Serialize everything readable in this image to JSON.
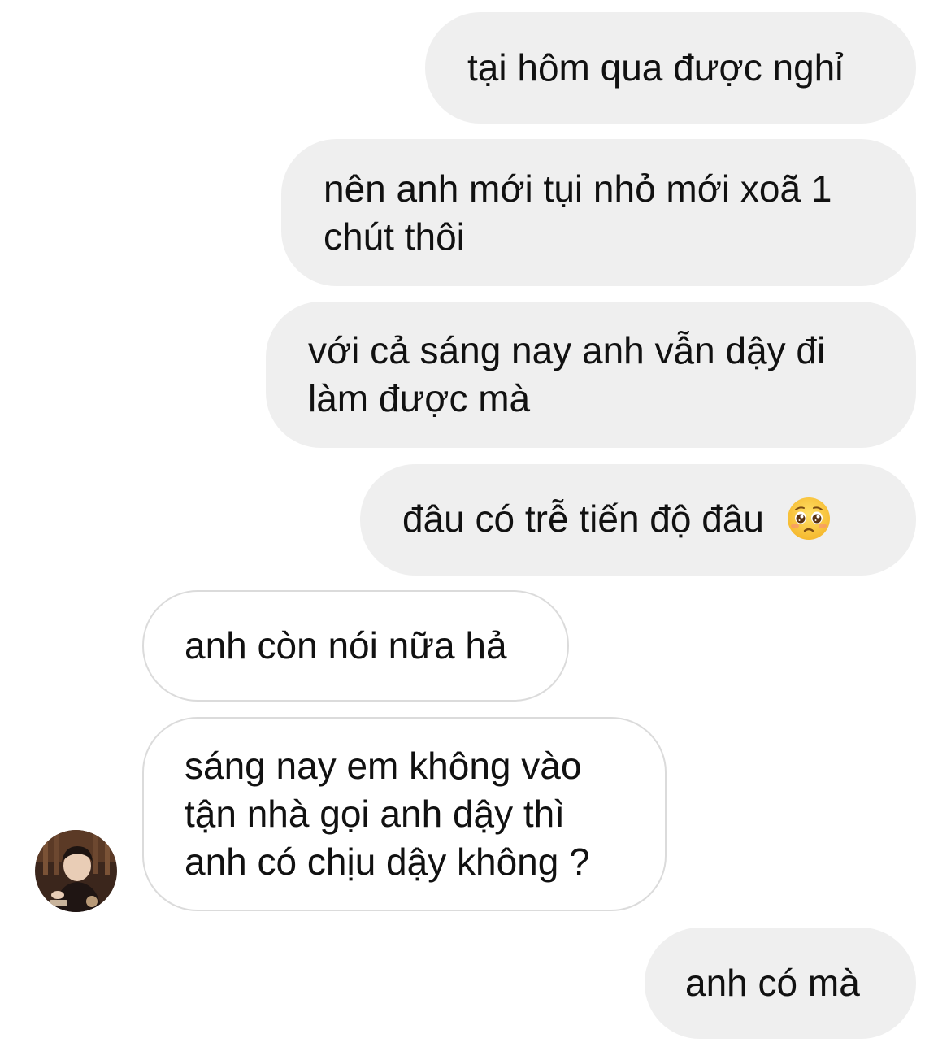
{
  "messages": [
    {
      "id": "m1",
      "from": "me",
      "text": "tại hôm qua được nghỉ"
    },
    {
      "id": "m2",
      "from": "me",
      "text": "nên anh mới tụi nhỏ mới xoã 1 chút thôi"
    },
    {
      "id": "m3",
      "from": "me",
      "text": "với cả sáng nay anh vẫn dậy đi làm được mà"
    },
    {
      "id": "m4",
      "from": "me",
      "text": "đâu có trễ tiến độ đâu",
      "emoji": "pleading-face-emoji"
    },
    {
      "id": "m5",
      "from": "them",
      "text": "anh còn nói nữa hả"
    },
    {
      "id": "m6",
      "from": "them",
      "text": "sáng nay em không vào tận nhà gọi anh dậy thì anh có chịu dậy không ?"
    },
    {
      "id": "m7",
      "from": "me",
      "text": "anh có mà"
    }
  ],
  "colors": {
    "sent_bubble": "#efefef",
    "received_border": "#dbdbdb",
    "text": "#111111",
    "background": "#ffffff"
  }
}
